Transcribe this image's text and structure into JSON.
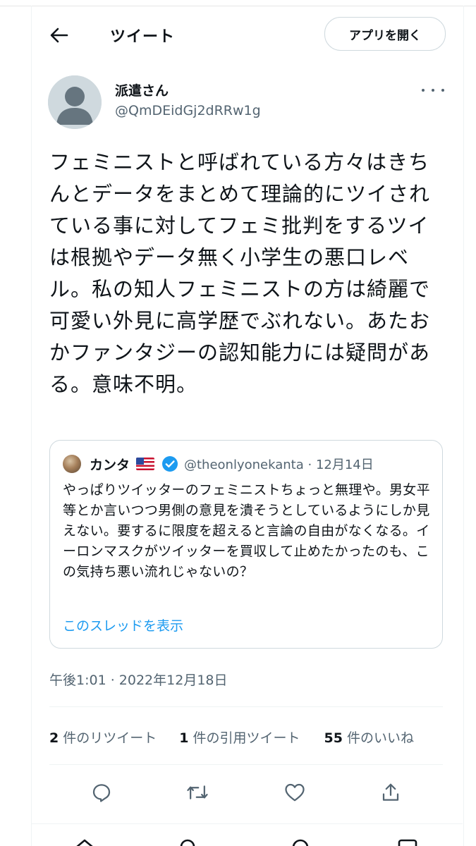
{
  "header": {
    "title": "ツイート",
    "open_app_label": "アプリを開く"
  },
  "tweet": {
    "author_name": "派遣さん",
    "author_handle": "@QmDEidGj2dRRw1g",
    "text": "フェミニストと呼ばれている方々はきちんとデータをまとめて理論的にツイされている事に対してフェミ批判をするツイは根拠やデータ無く小学生の悪口レベル。私の知人フェミニストの方は綺麗で可愛い外見に高学歴でぶれない。あたおかファンタジーの認知能力には疑問がある。意味不明。",
    "timestamp": "午後1:01 · 2022年12月18日"
  },
  "quote": {
    "name": "カンタ",
    "handle": "@theonlyonekanta",
    "separator": "·",
    "date": "12月14日",
    "text": "やっぱりツイッターのフェミニストちょっと無理や。男女平等とか言いつつ男側の意見を潰そうとしているようにしか見えない。要するに限度を超えると言論の自由がなくなる。イーロンマスクがツイッターを買収して止めたかったのも、この気持ち悪い流れじゃないの？",
    "show_thread": "このスレッドを表示"
  },
  "stats": {
    "retweets_count": "2",
    "retweets_label": "件のリツイート",
    "quotes_count": "1",
    "quotes_label": "件の引用ツイート",
    "likes_count": "55",
    "likes_label": "件のいいね"
  },
  "colors": {
    "text": "#0f1419",
    "secondary": "#536471",
    "link": "#1d9bf0",
    "border": "#cfd9de"
  },
  "icons": {
    "back": "arrow-left-icon",
    "more": "more-horizontal-icon",
    "reply": "reply-icon",
    "retweet": "retweet-icon",
    "like": "heart-icon",
    "share": "share-icon",
    "verified": "verified-badge-icon",
    "flag": "us-flag-icon"
  }
}
